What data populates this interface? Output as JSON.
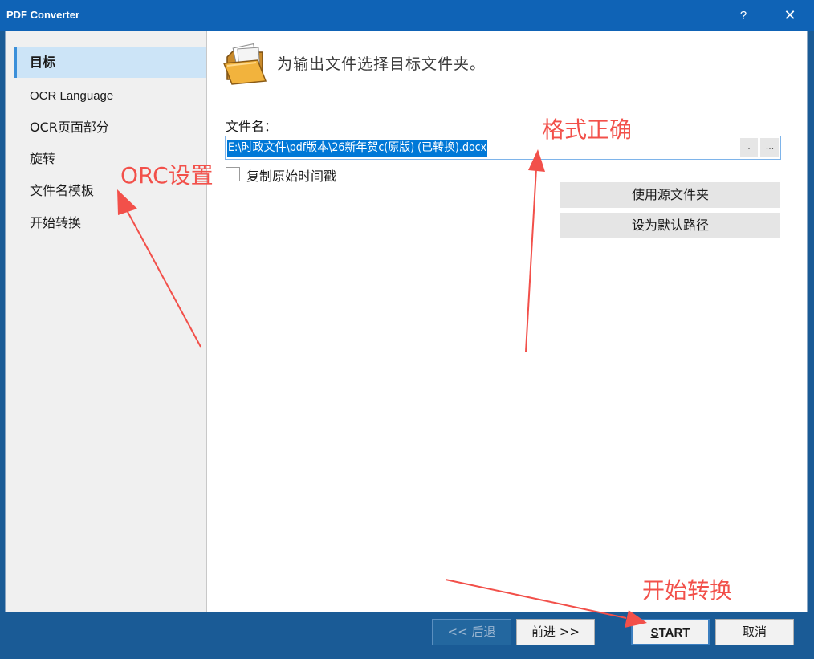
{
  "titlebar": {
    "title": "PDF Converter",
    "help_glyph": "?",
    "close_glyph": "✕"
  },
  "sidebar": {
    "items": [
      {
        "label": "目标"
      },
      {
        "label": "OCR Language"
      },
      {
        "label": "OCR页面部分"
      },
      {
        "label": "旋转"
      },
      {
        "label": "文件名模板"
      },
      {
        "label": "开始转换"
      }
    ]
  },
  "main": {
    "header_text": "为输出文件选择目标文件夹。",
    "filename_label": "文件名：",
    "filename_value": "E:\\时政文件\\pdf版本\\26新年贺c(原版) (已转换).docx",
    "browse_dot": ".",
    "browse_more": "...",
    "copy_timestamp_label": "复制原始时间戳",
    "use_source_folder": "使用源文件夹",
    "set_default_path": "设为默认路径"
  },
  "footer": {
    "back": "<< 后退",
    "next": "前进 >>",
    "start_underlined": "S",
    "start_rest": "TART",
    "cancel": "取消"
  },
  "annotations": {
    "orc_settings": "ORC设置",
    "format_correct": "格式正确",
    "start_convert": "开始转换",
    "color": "#f2504a"
  },
  "colors": {
    "titlebar": "#0f63b6",
    "footer": "#1a5b96",
    "selection": "#0078d7",
    "sidebar_active": "#cce4f7"
  }
}
